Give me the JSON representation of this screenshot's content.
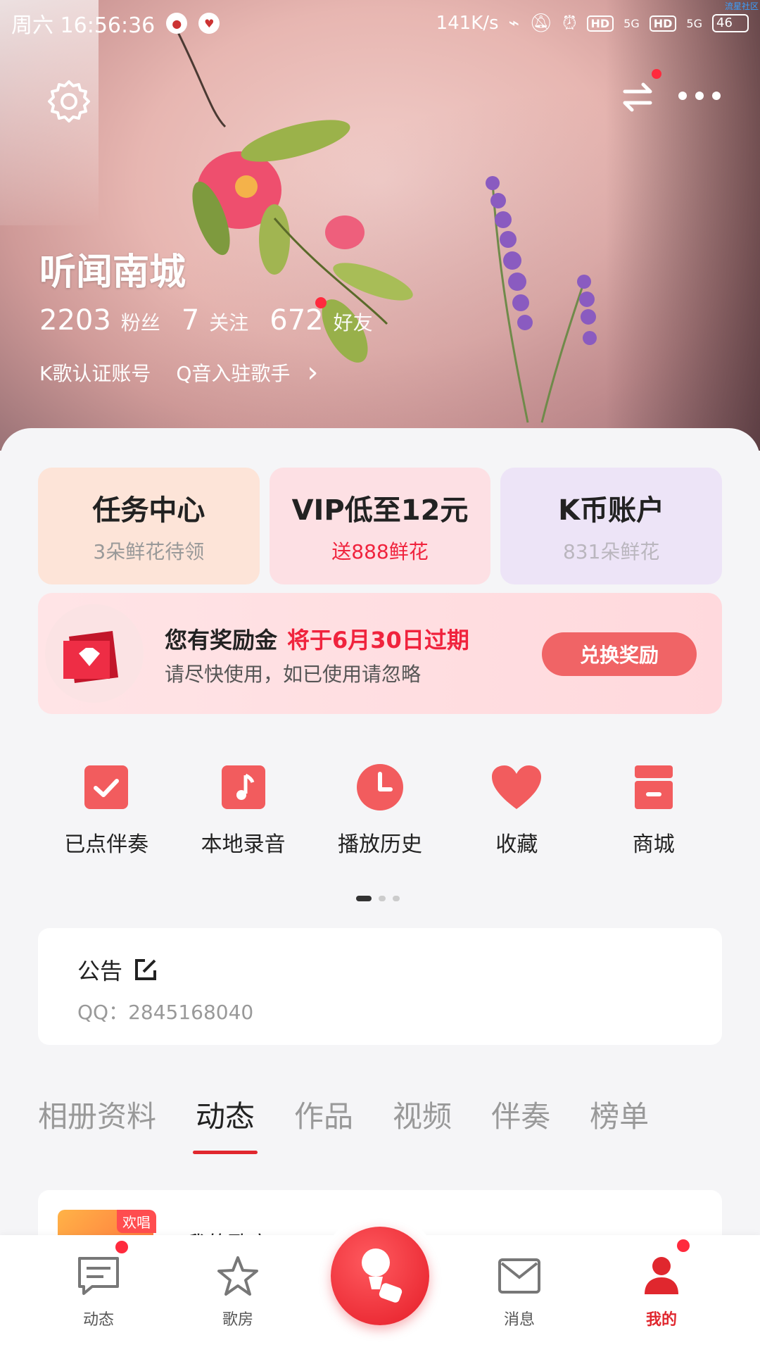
{
  "status_bar": {
    "time": "周六 16:56:36",
    "net_speed": "141K/s",
    "hd1": "HD",
    "sig1": "5G",
    "hd2": "HD",
    "sig2": "5G",
    "battery": "46",
    "watermark": "流星社区"
  },
  "profile": {
    "name": "听闻南城",
    "fans_count": "2203",
    "fans_label": "粉丝",
    "follow_count": "7",
    "follow_label": "关注",
    "friends_count": "672",
    "friends_label": "好友",
    "cert1": "K歌认证账号",
    "cert2": "Q音入驻歌手",
    "chevron": "›"
  },
  "cards": [
    {
      "title": "任务中心",
      "sub": "3朵鲜花待领"
    },
    {
      "title": "VIP低至12元",
      "sub": "送888鲜花"
    },
    {
      "title": "K币账户",
      "sub": "831朵鲜花"
    }
  ],
  "banner": {
    "title": "您有奖励金",
    "highlight": "将于6月30日过期",
    "sub": "请尽快使用，如已使用请忽略",
    "button": "兑换奖励"
  },
  "quick_actions": [
    {
      "label": "已点伴奏",
      "icon": "checkbox-icon"
    },
    {
      "label": "本地录音",
      "icon": "music-note-icon"
    },
    {
      "label": "播放历史",
      "icon": "clock-icon"
    },
    {
      "label": "收藏",
      "icon": "heart-icon"
    },
    {
      "label": "商城",
      "icon": "shop-icon"
    }
  ],
  "notice": {
    "title": "公告",
    "text": "QQ：2845168040"
  },
  "tabs": [
    "相册资料",
    "动态",
    "作品",
    "视频",
    "伴奏",
    "榜单"
  ],
  "feed": {
    "badge": "欢唱",
    "title": "我的歌房"
  },
  "bottom_nav": [
    {
      "label": "动态",
      "icon": "message-square-icon"
    },
    {
      "label": "歌房",
      "icon": "star-icon"
    },
    {
      "label": "消息",
      "icon": "mail-icon"
    },
    {
      "label": "我的",
      "icon": "user-icon"
    }
  ],
  "colors": {
    "accent": "#e0272e",
    "highlight_red": "#f0233d",
    "banner_button": "#f06466"
  }
}
